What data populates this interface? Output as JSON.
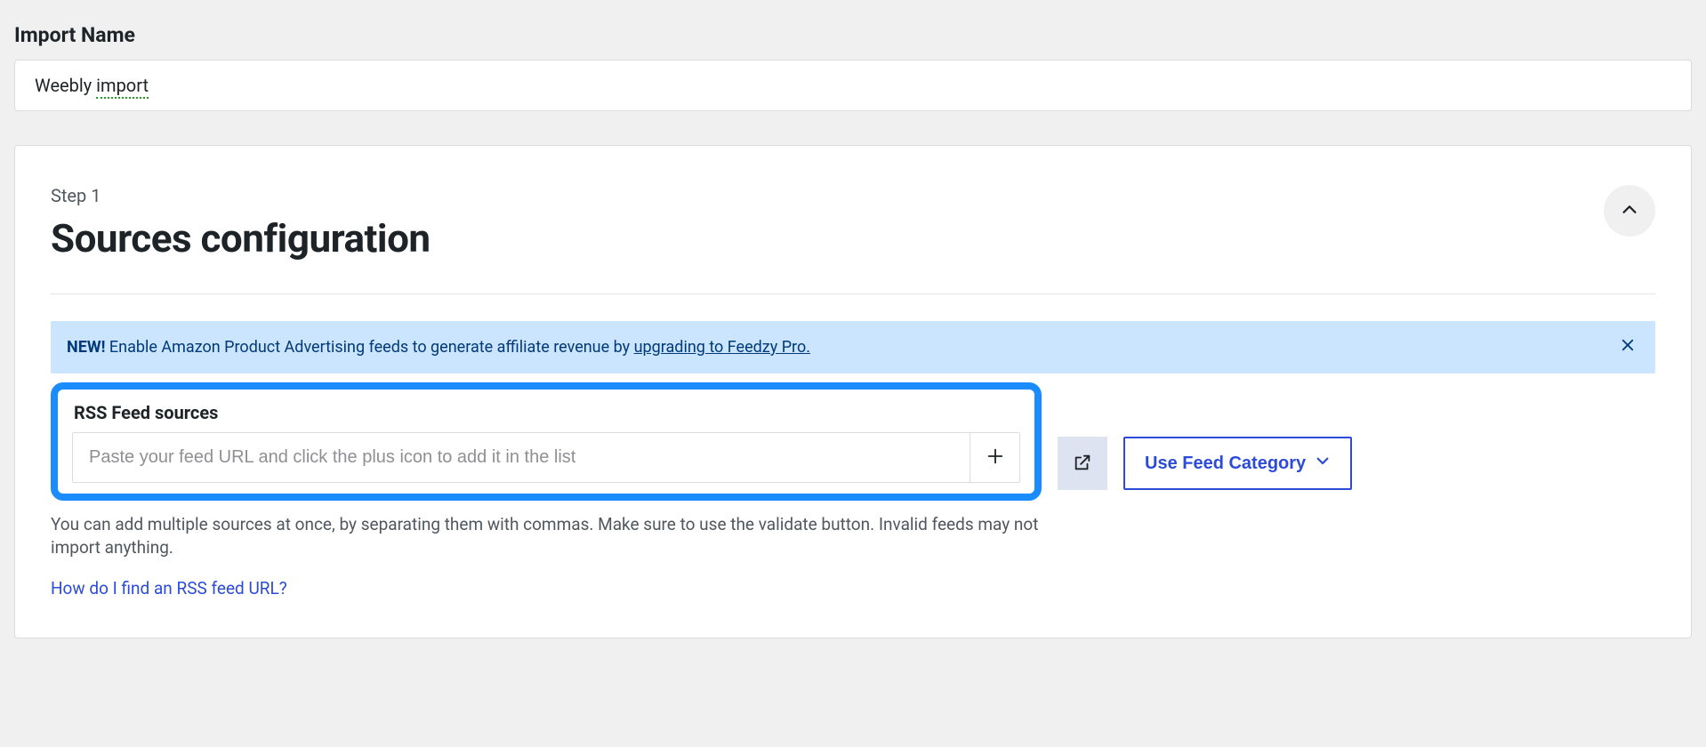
{
  "importName": {
    "label": "Import Name",
    "value_pre": "Weebly ",
    "value_spell": "import"
  },
  "panel": {
    "step": "Step 1",
    "title": "Sources configuration"
  },
  "notice": {
    "badge": "NEW!",
    "text": " Enable Amazon Product Advertising feeds to generate affiliate revenue by ",
    "linkText": "upgrading to Feedzy Pro."
  },
  "feed": {
    "sectionLabel": "RSS Feed sources",
    "placeholder": "Paste your feed URL and click the plus icon to add it in the list",
    "value": "",
    "useCategoryLabel": "Use Feed Category"
  },
  "helpText": "You can add multiple sources at once, by separating them with commas. Make sure to use the validate button. Invalid feeds may not import anything.",
  "helpLinkText": "How do I find an RSS feed URL?"
}
